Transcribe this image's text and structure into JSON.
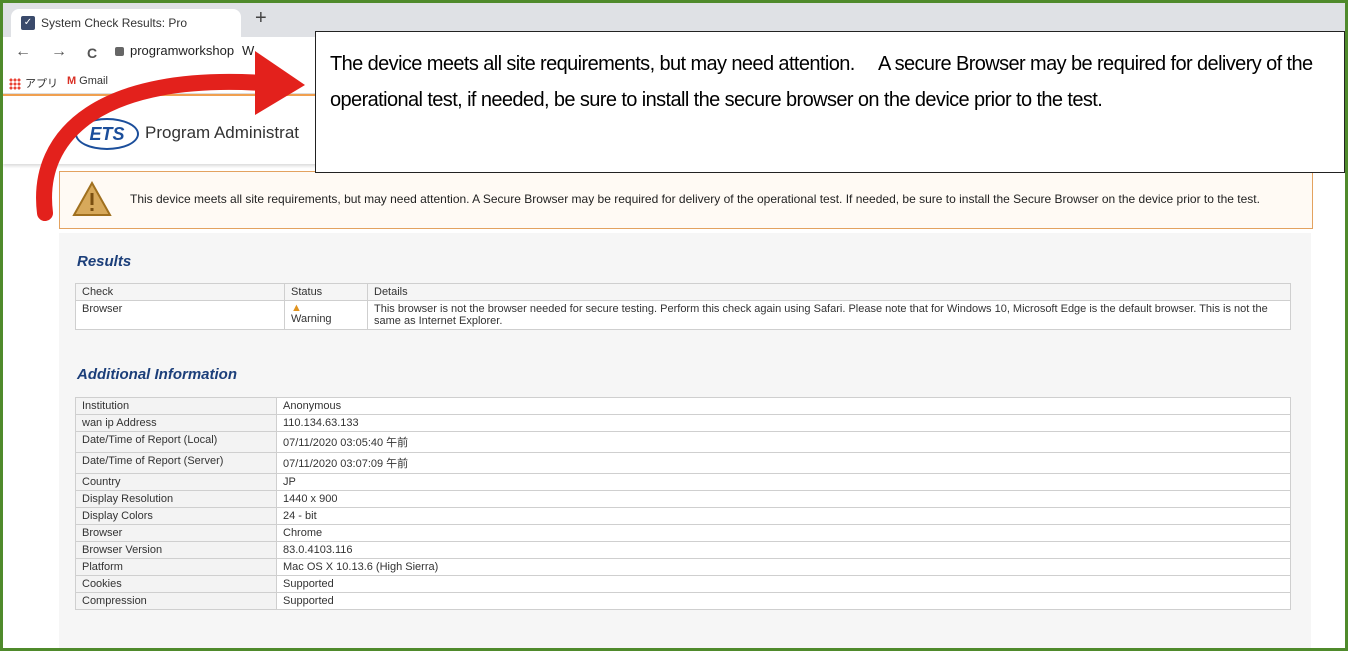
{
  "browser": {
    "tab_title": "System Check Results: Pro",
    "new_tab": "+",
    "url": "programworkshop",
    "url_suffix": "W",
    "bookmarks": [
      {
        "label": "アプリ",
        "icon": "apps-grid-icon"
      },
      {
        "label": "Gmail",
        "icon": "gmail-icon"
      }
    ],
    "nav": {
      "back": "←",
      "forward": "→",
      "reload": "C"
    }
  },
  "site": {
    "logo_text": "ETS",
    "title": "Program Administrat"
  },
  "callout": {
    "text": "The device meets all site requirements, but may need attention.　 A secure Browser may be required for delivery of the operational test, if needed, be sure to install the secure browser on the device prior to the test."
  },
  "alert": {
    "icon": "warning-triangle-icon",
    "text": "This device meets all site requirements, but may need attention. A Secure Browser may be required for delivery of the operational test. If needed, be sure to install the Secure Browser on the device prior to the test."
  },
  "results": {
    "heading": "Results",
    "columns": [
      "Check",
      "Status",
      "Details"
    ],
    "rows": [
      {
        "check": "Browser",
        "status": "Warning",
        "details": "This browser is not the browser needed for secure testing. Perform this check again using Safari. Please note that for Windows 10, Microsoft Edge is the default browser. This is not the same as Internet Explorer."
      }
    ]
  },
  "additional": {
    "heading": "Additional Information",
    "rows": [
      {
        "label": "Institution",
        "value": "Anonymous"
      },
      {
        "label": "wan ip Address",
        "value": "110.134.63.133"
      },
      {
        "label": "Date/Time of Report (Local)",
        "value": "07/11/2020 03:05:40 午前"
      },
      {
        "label": "Date/Time of Report (Server)",
        "value": "07/11/2020 03:07:09 午前"
      },
      {
        "label": "Country",
        "value": "JP"
      },
      {
        "label": "Display Resolution",
        "value": "1440 x 900"
      },
      {
        "label": "Display Colors",
        "value": "24 - bit"
      },
      {
        "label": "Browser",
        "value": "Chrome"
      },
      {
        "label": "Browser Version",
        "value": "83.0.4103.116"
      },
      {
        "label": "Platform",
        "value": "Mac OS X 10.13.6 (High Sierra)"
      },
      {
        "label": "Cookies",
        "value": "Supported"
      },
      {
        "label": "Compression",
        "value": "Supported"
      }
    ]
  },
  "colors": {
    "frame_border": "#4f8a2b",
    "heading": "#1c3f7a",
    "alert_border": "#e3a25f",
    "arrow": "#e3211c"
  }
}
